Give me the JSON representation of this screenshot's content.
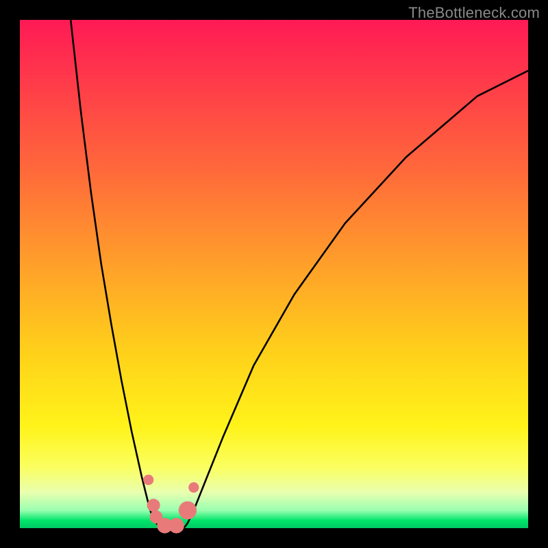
{
  "watermark": "TheBottleneck.com",
  "colors": {
    "frame": "#000000",
    "curve": "#000000",
    "marker_fill": "#e97a7a",
    "marker_stroke": "#e97a7a"
  },
  "chart_data": {
    "type": "line",
    "title": "",
    "xlabel": "",
    "ylabel": "",
    "xlim": [
      0,
      100
    ],
    "ylim": [
      0,
      100
    ],
    "series": [
      {
        "name": "left-curve",
        "x": [
          10,
          12,
          14,
          16,
          18,
          20,
          22,
          24,
          25,
          25.5,
          26,
          26.5,
          27,
          27.5,
          28
        ],
        "y": [
          100,
          82,
          66,
          52,
          40,
          29,
          19,
          10,
          6,
          4,
          2.5,
          1.5,
          0.8,
          0.3,
          0
        ]
      },
      {
        "name": "right-curve",
        "x": [
          32,
          32.5,
          33,
          34,
          36,
          40,
          46,
          54,
          64,
          76,
          90,
          100
        ],
        "y": [
          0,
          0.3,
          1,
          3,
          8,
          18,
          32,
          46,
          60,
          73,
          85,
          90
        ]
      }
    ],
    "markers": [
      {
        "x": 25.3,
        "y": 9.5,
        "r": 4
      },
      {
        "x": 26.3,
        "y": 4.5,
        "r": 5
      },
      {
        "x": 26.8,
        "y": 2.2,
        "r": 5
      },
      {
        "x": 28.5,
        "y": 0.5,
        "r": 6
      },
      {
        "x": 30.8,
        "y": 0.5,
        "r": 6
      },
      {
        "x": 33.0,
        "y": 3.5,
        "r": 7
      },
      {
        "x": 34.2,
        "y": 8.0,
        "r": 4
      }
    ]
  }
}
